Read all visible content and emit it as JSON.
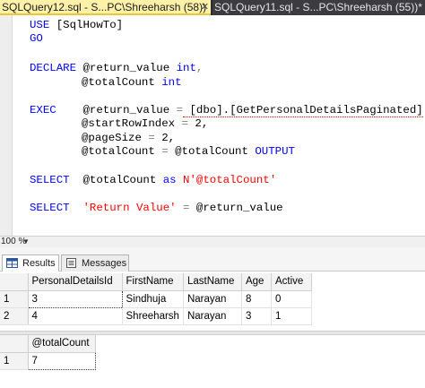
{
  "tabs": [
    {
      "label": "SQLQuery12.sql - S...PC\\Shreeharsh (58))"
    },
    {
      "label": "SQLQuery11.sql - S...PC\\Shreeharsh (55))*"
    }
  ],
  "editor": {
    "line1": {
      "kw": "USE",
      "rest": " [SqlHowTo]"
    },
    "line2": {
      "kw": "GO"
    },
    "line4": {
      "kw": "DECLARE",
      "var": " @return_value ",
      "type": "int",
      "comma": ","
    },
    "line5": {
      "var": "@totalCount ",
      "type": "int"
    },
    "line7": {
      "kw": "EXEC",
      "a": "    @return_value ",
      "eq": "=",
      "obj": " [dbo].[GetPersonalDetailsPaginated]"
    },
    "line8": {
      "a": "@startRowIndex ",
      "eq": "=",
      "b": " 2,"
    },
    "line9": {
      "a": "@pageSize ",
      "eq": "=",
      "b": " 2,"
    },
    "line10": {
      "a": "@totalCount ",
      "eq": "=",
      "b": " @totalCount ",
      "kw": "OUTPUT"
    },
    "line12": {
      "kw": "SELECT",
      "a": "  @totalCount ",
      "as": "as",
      "str": " N'@totalCount'"
    },
    "line14": {
      "kw": "SELECT",
      "str": "  'Return Value'",
      "eq": " =",
      "b": " @return_value"
    }
  },
  "zoom": {
    "level": "100 %"
  },
  "results_tabs": {
    "results": "Results",
    "messages": "Messages"
  },
  "grid1": {
    "columns": [
      "PersonalDetailsId",
      "FirstName",
      "LastName",
      "Age",
      "Active"
    ],
    "rows": [
      {
        "n": "1",
        "cells": [
          "3",
          "Sindhuja",
          "Narayan",
          "8",
          "0"
        ]
      },
      {
        "n": "2",
        "cells": [
          "4",
          "Shreeharsh",
          "Narayan",
          "3",
          "1"
        ]
      }
    ]
  },
  "grid2": {
    "columns": [
      "@totalCount"
    ],
    "rows": [
      {
        "n": "1",
        "cells": [
          "7"
        ]
      }
    ]
  }
}
